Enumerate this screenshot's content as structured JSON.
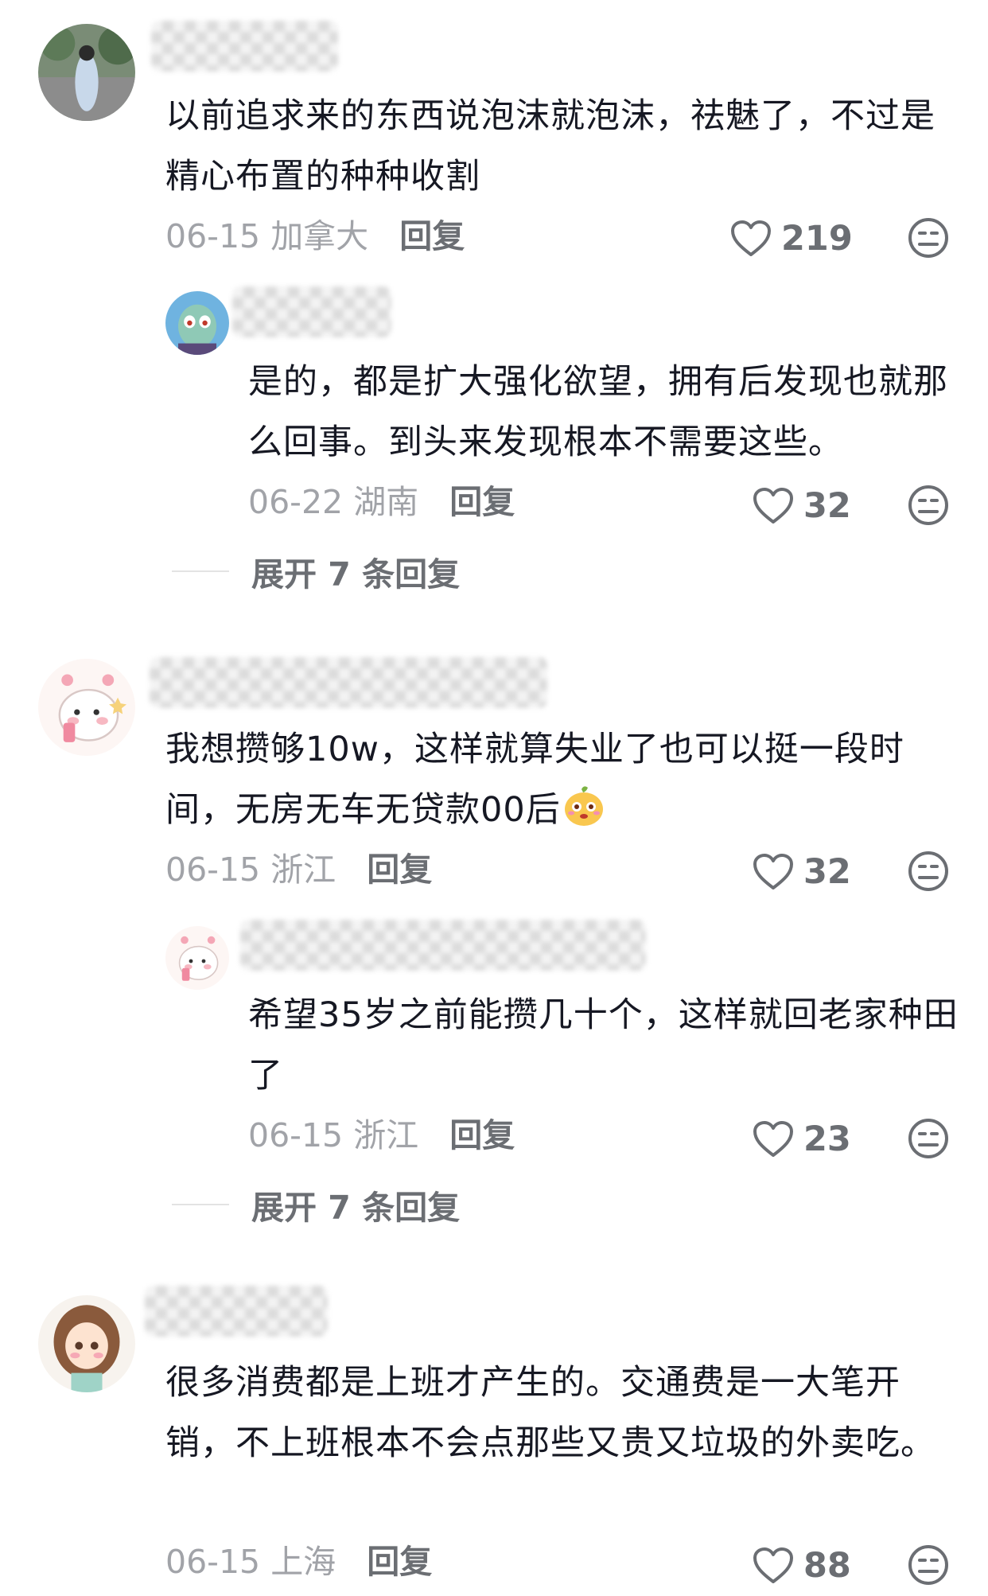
{
  "comments": [
    {
      "text": "以前追求来的东西说泡沫就泡沫，祛魅了，不过是精心布置的种种收割",
      "date": "06-15",
      "location": "加拿大",
      "reply_label": "回复",
      "likes": "219",
      "replies": [
        {
          "text": "是的，都是扩大强化欲望，拥有后发现也就那么回事。到头来发现根本不需要这些。",
          "date": "06-22",
          "location": "湖南",
          "reply_label": "回复",
          "likes": "32"
        }
      ],
      "expand_label": "展开 7 条回复"
    },
    {
      "text": "我想攒够10w，这样就算失业了也可以挺一段时间，无房无车无贷款00后",
      "date": "06-15",
      "location": "浙江",
      "reply_label": "回复",
      "likes": "32",
      "replies": [
        {
          "text": "希望35岁之前能攒几十个，这样就回老家种田了",
          "date": "06-15",
          "location": "浙江",
          "reply_label": "回复",
          "likes": "23"
        }
      ],
      "expand_label": "展开 7 条回复"
    },
    {
      "text": "很多消费都是上班才产生的。交通费是一大笔开销，不上班根本不会点那些又贵又垃圾的外卖吃。",
      "date": "06-15",
      "location": "上海",
      "reply_label": "回复",
      "likes": "88"
    }
  ],
  "icons": {
    "like": "heart-outline-icon",
    "dislike": "meh-face-icon",
    "emoji": "cute-mascot-emoji"
  },
  "colors": {
    "primary_text": "#161823",
    "meta_text": "#a1a3a8",
    "action_text": "#6b6e73"
  }
}
